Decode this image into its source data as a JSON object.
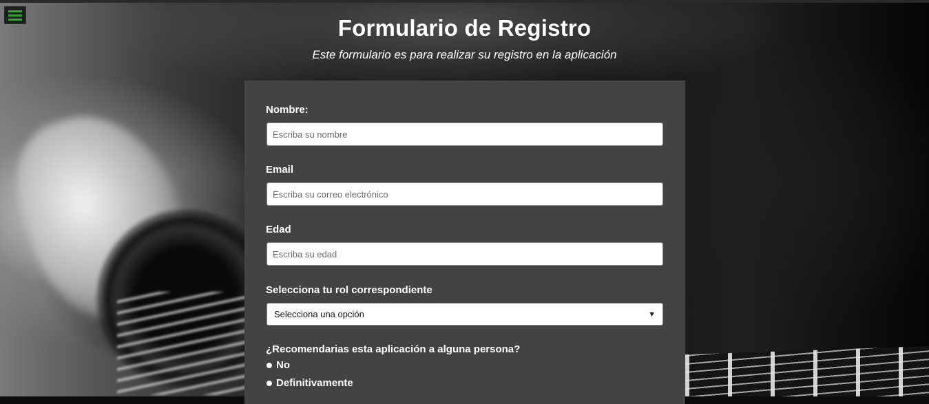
{
  "header": {
    "title": "Formulario de Registro",
    "subtitle": "Este formulario es para realizar su registro en la aplicación"
  },
  "menu": {
    "icon": "hamburger-menu-icon",
    "color": "#10c010"
  },
  "form": {
    "name": {
      "label": "Nombre:",
      "placeholder": "Escriba su nombre",
      "value": ""
    },
    "email": {
      "label": "Email",
      "placeholder": "Escriba su correo electrónico",
      "value": ""
    },
    "age": {
      "label": "Edad",
      "placeholder": "Escriba su edad",
      "value": ""
    },
    "role": {
      "label": "Selecciona tu rol correspondiente",
      "selected": "Selecciona una opción"
    },
    "recommend": {
      "question": "¿Recomendarias esta aplicación a alguna persona?",
      "options": [
        "No",
        "Definitivamente"
      ]
    }
  },
  "colors": {
    "panel": "#454341",
    "text": "#ffffff",
    "accent": "#10c010"
  }
}
